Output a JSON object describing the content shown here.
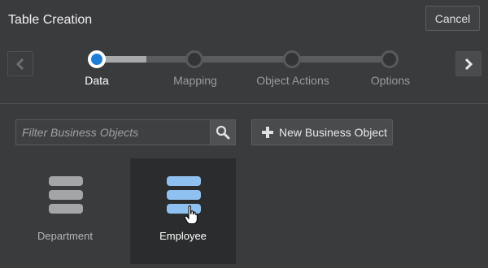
{
  "window": {
    "title": "Table Creation",
    "cancel_label": "Cancel"
  },
  "train": {
    "prev_icon": "chevron-left-icon",
    "next_icon": "chevron-right-icon",
    "steps": [
      {
        "label": "Data",
        "state": "active"
      },
      {
        "label": "Mapping",
        "state": "pending"
      },
      {
        "label": "Object Actions",
        "state": "pending"
      },
      {
        "label": "Options",
        "state": "pending"
      }
    ]
  },
  "toolbar": {
    "filter_placeholder": "Filter Business Objects",
    "filter_value": "",
    "search_icon": "search-icon",
    "new_button_label": "New Business Object",
    "new_button_icon": "plus-icon"
  },
  "business_objects": [
    {
      "label": "Department",
      "icon": "database-icon",
      "selected": false
    },
    {
      "label": "Employee",
      "icon": "database-icon",
      "selected": true
    }
  ],
  "colors": {
    "background": "#3a3b3d",
    "accent": "#1f7fd6",
    "selected_icon": "#8fc1f0",
    "unselected_icon": "#a4a5a7"
  }
}
